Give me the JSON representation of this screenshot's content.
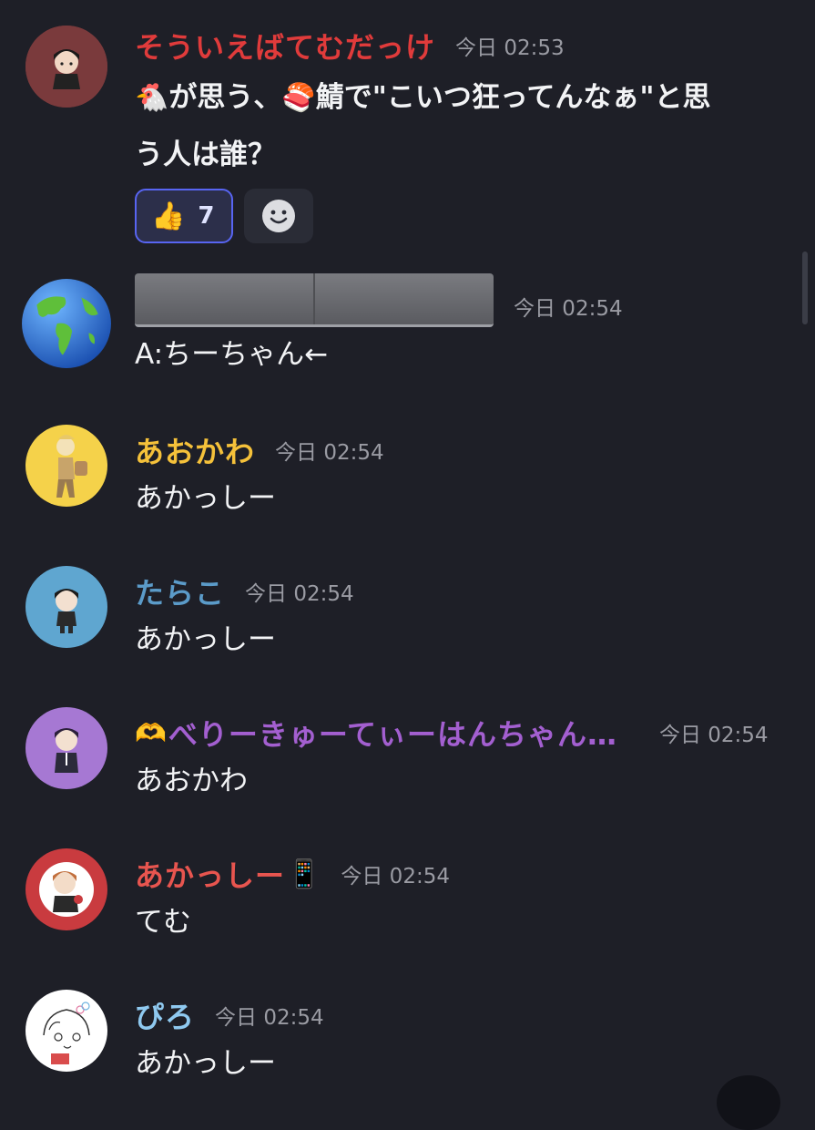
{
  "messages": [
    {
      "author": "そういえばてむだっけ",
      "author_color": "#e03b3b",
      "time": "今日 02:53",
      "text_emoji_1": "🐔",
      "text_part_1": "が思う、",
      "text_emoji_2": "🍣",
      "text_part_2": "鯖で\"こいつ狂ってんなぁ\"と思",
      "text_line_2": "う人は誰？",
      "reaction": {
        "emoji": "👍",
        "count": "7"
      },
      "avatar_bg": "#7a3a3c"
    },
    {
      "author": "",
      "time": "今日 02:54",
      "text": "A:ちーちゃん←",
      "avatar_name": "earth-globe"
    },
    {
      "author": "あおかわ",
      "author_color": "#f5c13a",
      "time": "今日 02:54",
      "text": "あかっしー",
      "avatar_bg": "#f5d24a"
    },
    {
      "author": "たらこ",
      "author_color": "#5b9bc9",
      "time": "今日 02:54",
      "text": "あかっしー",
      "avatar_bg": "#5fa6d0"
    },
    {
      "author_emoji": "🫶",
      "author": "べりーきゅーてぃーはんちゃん…",
      "author_color": "#a35fd0",
      "time": "今日 02:54",
      "text": "あおかわ",
      "avatar_bg": "#a678d3"
    },
    {
      "author": "あかっしー",
      "author_emoji_after": "📱",
      "author_color": "#e8554f",
      "time": "今日 02:54",
      "text": "てむ",
      "avatar_bg": "#c93b3f"
    },
    {
      "author": "ぴろ",
      "author_color": "#8fc9f0",
      "time": "今日 02:54",
      "text": "あかっしー",
      "avatar_bg": "#ffffff"
    }
  ],
  "icons": {
    "add_reaction": "smiley-face-icon"
  }
}
